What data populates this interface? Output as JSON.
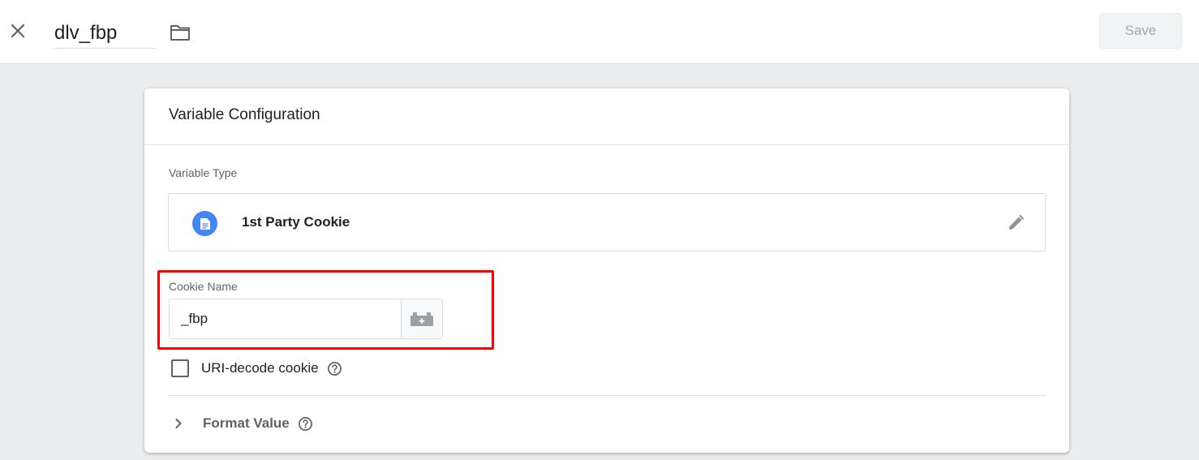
{
  "header": {
    "close_icon": "close-icon",
    "variable_name": "dlv_fbp",
    "folder_icon": "folder-icon",
    "save_label": "Save"
  },
  "card": {
    "title": "Variable Configuration",
    "variable_type_label": "Variable Type",
    "variable_type": {
      "icon": "document-icon",
      "icon_color": "#4285f4",
      "name": "1st Party Cookie",
      "edit_icon": "pencil-icon"
    },
    "cookie_name": {
      "label": "Cookie Name",
      "value": "_fbp",
      "picker_icon": "variable-picker-icon"
    },
    "uri_decode": {
      "label": "URI-decode cookie",
      "checked": false,
      "help_icon": "help-icon"
    },
    "format_value": {
      "label": "Format Value",
      "expand_icon": "chevron-right-icon",
      "help_icon": "help-icon"
    }
  },
  "colors": {
    "highlight": "#ff0000",
    "accent": "#4285f4"
  }
}
